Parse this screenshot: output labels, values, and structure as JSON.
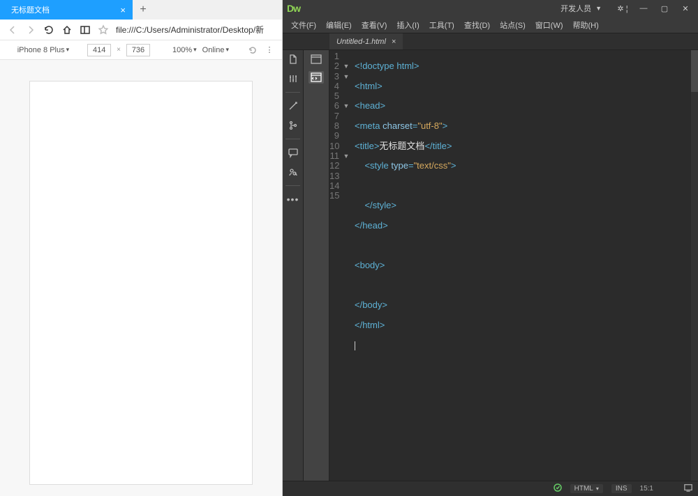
{
  "browser": {
    "tab_title": "无标题文档",
    "url": "file:///C:/Users/Administrator/Desktop/新",
    "device": "iPhone 8 Plus",
    "width": "414",
    "height": "736",
    "zoom": "100%",
    "network": "Online"
  },
  "dw": {
    "logo": "Dw",
    "workspace": "开发人员",
    "menus": [
      "文件(F)",
      "编辑(E)",
      "查看(V)",
      "插入(I)",
      "工具(T)",
      "查找(D)",
      "站点(S)",
      "窗口(W)",
      "帮助(H)"
    ],
    "doc_tab": "Untitled-1.html",
    "line_numbers": [
      "1",
      "2",
      "3",
      "4",
      "5",
      "6",
      "7",
      "8",
      "9",
      "10",
      "11",
      "12",
      "13",
      "14",
      "15"
    ],
    "fold_marks": [
      "",
      "▼",
      "▼",
      "",
      "",
      "▼",
      "",
      "",
      "",
      "",
      "▼",
      "",
      "",
      "",
      ""
    ],
    "status": {
      "lang": "HTML",
      "ins": "INS",
      "pos": "15:1"
    },
    "code": {
      "l1a": "<!doctype html>",
      "l2a": "<html>",
      "l3a": "<head>",
      "l4a": "<meta ",
      "l4b": "charset",
      "l4c": "=",
      "l4d": "\"utf-8\"",
      "l4e": ">",
      "l5a": "<title>",
      "l5b": "无标题文档",
      "l5c": "</title>",
      "l6a": "<style ",
      "l6b": "type",
      "l6c": "=",
      "l6d": "\"text/css\"",
      "l6e": ">",
      "l8a": "</style>",
      "l9a": "</head>",
      "l11a": "<body>",
      "l13a": "</body>",
      "l14a": "</html>"
    }
  }
}
